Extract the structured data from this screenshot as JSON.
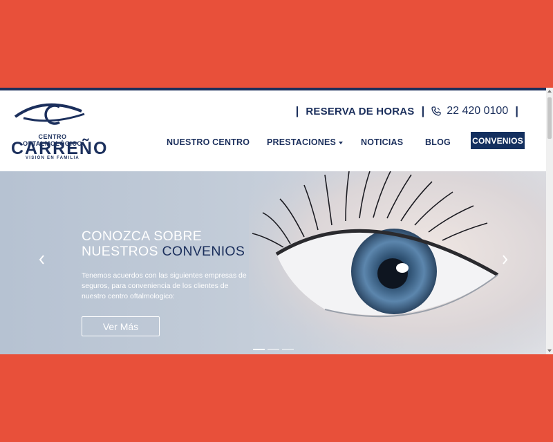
{
  "brand": {
    "small": "CENTRO OFTALMOLÓGICO",
    "name": "CARREÑO",
    "tagline": "VISIÓN EN FAMILIA",
    "primary_color": "#1b2f5c"
  },
  "topbar": {
    "separator": "|",
    "reserva": "RESERVA DE HORAS",
    "phone": "22 420 0100"
  },
  "nav": {
    "items": [
      "NUESTRO CENTRO",
      "PRESTACIONES",
      "NOTICIAS",
      "BLOG"
    ],
    "cta": "CONVENIOS"
  },
  "hero": {
    "title_line1": "CONOZCA SOBRE",
    "title_line2_a": "NUESTROS ",
    "title_line2_b": "CONVENIOS",
    "text": "Tenemos acuerdos con las siguientes empresas de seguros, para conveniencia de los clientes de nuestro centro oftalmologico:",
    "button": "Ver Más",
    "slides": 3,
    "active_slide": 1
  },
  "colors": {
    "background_outer": "#e8503a",
    "accent": "#14305f"
  }
}
